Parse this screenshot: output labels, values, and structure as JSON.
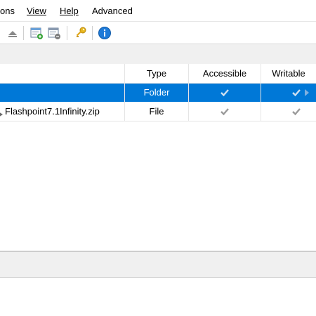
{
  "menu": {
    "options_visible_text": "ons",
    "view": "View",
    "help": "Help",
    "advanced": "Advanced"
  },
  "toolbar": {
    "icons": [
      "up-arrow-icon",
      "add-item-icon",
      "remove-item-icon",
      "key-icon",
      "info-icon"
    ]
  },
  "table": {
    "columns": [
      "Type",
      "Accessible",
      "Writable"
    ],
    "rows": [
      {
        "name": "",
        "type": "Folder",
        "accessible": "check",
        "writable": "check",
        "selected": true
      },
      {
        "name": "Flashpoint7.1Infinity.zip",
        "type": "File",
        "accessible": "check",
        "writable": "check",
        "selected": false
      }
    ]
  },
  "colors": {
    "selection": "#0078d7",
    "info_icon": "#1e7ad8"
  }
}
